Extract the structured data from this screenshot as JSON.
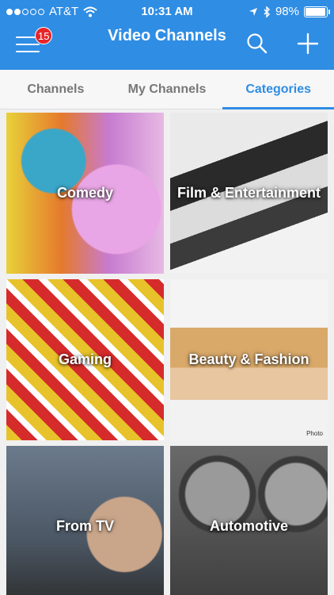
{
  "status_bar": {
    "carrier": "AT&T",
    "time": "10:31 AM",
    "battery": "98%",
    "battery_level": 0.98,
    "signal_bars": 2
  },
  "header": {
    "title": "Video Channels",
    "badge_count": "15",
    "color": "#2f8de4"
  },
  "tabs": [
    {
      "label": "Channels"
    },
    {
      "label": "My Channels"
    },
    {
      "label": "Categories",
      "active": true
    }
  ],
  "categories": [
    {
      "label": "Comedy"
    },
    {
      "label": "Film & Entertainment"
    },
    {
      "label": "Gaming"
    },
    {
      "label": "Beauty & Fashion",
      "watermark": "Photo"
    },
    {
      "label": "From TV"
    },
    {
      "label": "Automotive"
    }
  ]
}
